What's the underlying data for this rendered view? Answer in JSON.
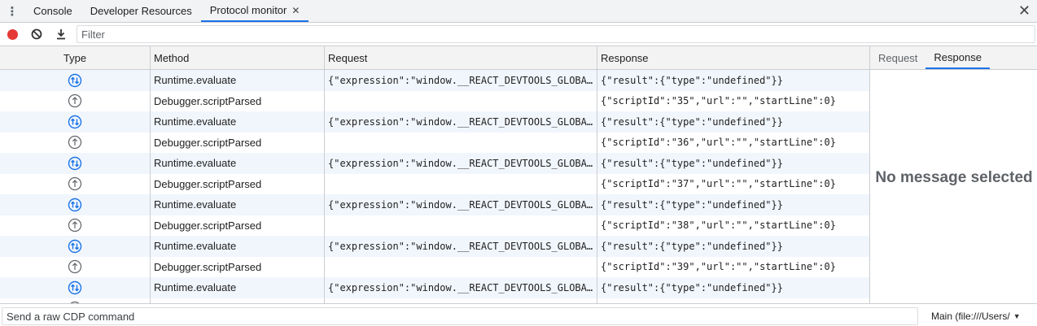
{
  "tabs": [
    {
      "label": "Console",
      "active": false
    },
    {
      "label": "Developer Resources",
      "active": false
    },
    {
      "label": "Protocol monitor",
      "active": true
    }
  ],
  "toolbar": {
    "filter_placeholder": "Filter",
    "record_icon": "record-icon",
    "clear_icon": "clear-icon",
    "download_icon": "download-icon"
  },
  "grid": {
    "headers": {
      "type": "Type",
      "method": "Method",
      "request": "Request",
      "response": "Response"
    },
    "rows": [
      {
        "type": "sent",
        "method": "Runtime.evaluate",
        "request": "{\"expression\":\"window.__REACT_DEVTOOLS_GLOBAL_HOOK__\"}",
        "response": "{\"result\":{\"type\":\"undefined\"}}"
      },
      {
        "type": "received",
        "method": "Debugger.scriptParsed",
        "request": "",
        "response": "{\"scriptId\":\"35\",\"url\":\"\",\"startLine\":0}"
      },
      {
        "type": "sent",
        "method": "Runtime.evaluate",
        "request": "{\"expression\":\"window.__REACT_DEVTOOLS_GLOBAL_HOOK__\"}",
        "response": "{\"result\":{\"type\":\"undefined\"}}"
      },
      {
        "type": "received",
        "method": "Debugger.scriptParsed",
        "request": "",
        "response": "{\"scriptId\":\"36\",\"url\":\"\",\"startLine\":0}"
      },
      {
        "type": "sent",
        "method": "Runtime.evaluate",
        "request": "{\"expression\":\"window.__REACT_DEVTOOLS_GLOBAL_HOOK__\"}",
        "response": "{\"result\":{\"type\":\"undefined\"}}"
      },
      {
        "type": "received",
        "method": "Debugger.scriptParsed",
        "request": "",
        "response": "{\"scriptId\":\"37\",\"url\":\"\",\"startLine\":0}"
      },
      {
        "type": "sent",
        "method": "Runtime.evaluate",
        "request": "{\"expression\":\"window.__REACT_DEVTOOLS_GLOBAL_HOOK__\"}",
        "response": "{\"result\":{\"type\":\"undefined\"}}"
      },
      {
        "type": "received",
        "method": "Debugger.scriptParsed",
        "request": "",
        "response": "{\"scriptId\":\"38\",\"url\":\"\",\"startLine\":0}"
      },
      {
        "type": "sent",
        "method": "Runtime.evaluate",
        "request": "{\"expression\":\"window.__REACT_DEVTOOLS_GLOBAL_HOOK__\"}",
        "response": "{\"result\":{\"type\":\"undefined\"}}"
      },
      {
        "type": "received",
        "method": "Debugger.scriptParsed",
        "request": "",
        "response": "{\"scriptId\":\"39\",\"url\":\"\",\"startLine\":0}"
      },
      {
        "type": "sent",
        "method": "Runtime.evaluate",
        "request": "{\"expression\":\"window.__REACT_DEVTOOLS_GLOBAL_HOOK__\"}",
        "response": "{\"result\":{\"type\":\"undefined\"}}"
      },
      {
        "type": "received",
        "method": "",
        "request": "",
        "response": ""
      }
    ]
  },
  "side": {
    "tabs": [
      {
        "label": "Request",
        "active": false
      },
      {
        "label": "Response",
        "active": true
      }
    ],
    "empty_message": "No message selected"
  },
  "bottom": {
    "command_placeholder": "Send a raw CDP command",
    "target": "Main (file:///Users/"
  },
  "colors": {
    "accent": "#1a73e8",
    "record": "#e53935",
    "row_stripe": "#f1f6fd"
  }
}
